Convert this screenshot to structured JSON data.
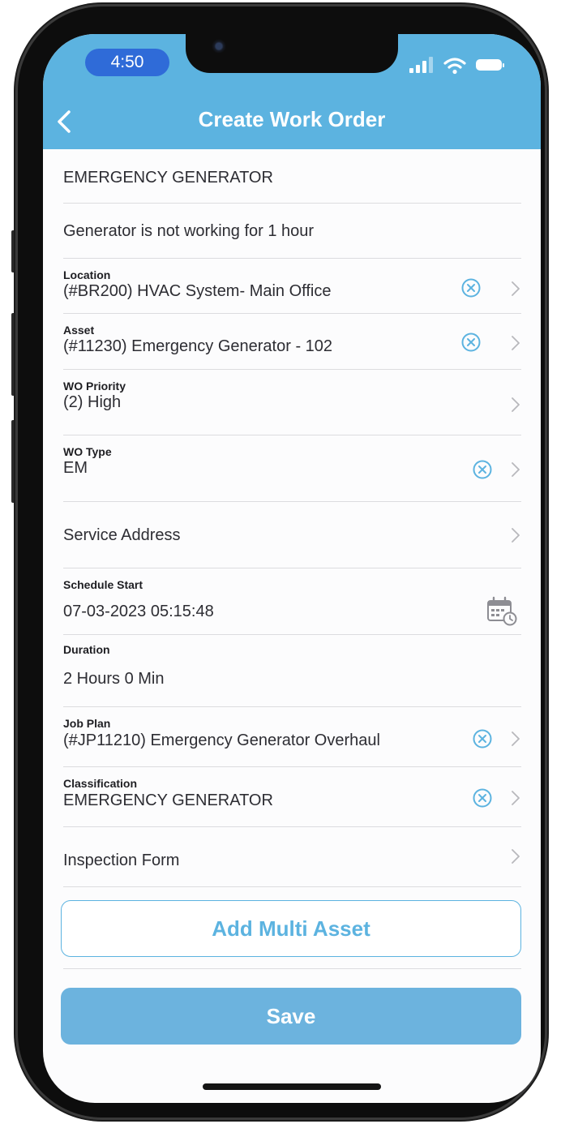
{
  "status_bar": {
    "time": "4:50"
  },
  "header": {
    "title": "Create Work Order"
  },
  "form": {
    "asset_title": "EMERGENCY GENERATOR",
    "description": "Generator is not working for 1 hour",
    "location": {
      "label": "Location",
      "value": "(#BR200) HVAC System- Main Office"
    },
    "asset": {
      "label": "Asset",
      "value": "(#11230) Emergency Generator - 102"
    },
    "wo_priority": {
      "label": "WO Priority",
      "value": "(2) High"
    },
    "wo_type": {
      "label": "WO Type",
      "value": "EM"
    },
    "service_address": {
      "label": "Service Address"
    },
    "schedule_start": {
      "label": "Schedule Start",
      "value": "07-03-2023 05:15:48"
    },
    "duration": {
      "label": "Duration",
      "value": "2 Hours 0 Min"
    },
    "job_plan": {
      "label": "Job Plan",
      "value": "(#JP11210) Emergency Generator Overhaul"
    },
    "classification": {
      "label": "Classification",
      "value": "EMERGENCY GENERATOR"
    },
    "inspection_form": {
      "label": "Inspection Form"
    }
  },
  "buttons": {
    "add_multi_asset": "Add Multi Asset",
    "save": "Save"
  },
  "colors": {
    "header": "#5cb3e0",
    "accent": "#5cb3e0",
    "save_button": "#6cb3de"
  },
  "icons": [
    "back-chevron-icon",
    "clear-circle-icon",
    "chevron-right-icon",
    "calendar-clock-icon"
  ]
}
